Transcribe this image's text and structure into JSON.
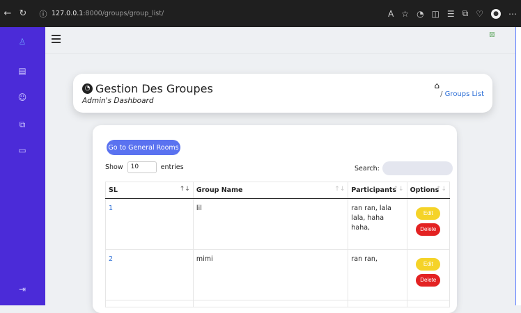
{
  "browser": {
    "url_host": "127.0.0.1",
    "url_rest": ":8000/groups/group_list/"
  },
  "header": {
    "title": "Gestion Des Groupes",
    "subtitle": "Admin's Dashboard",
    "breadcrumb_sep": "/",
    "breadcrumb_link": "Groups List"
  },
  "toolbar": {
    "rooms_button": "Go to General Rooms",
    "show_label": "Show",
    "entries_value": "10",
    "entries_label": "entries",
    "search_label": "Search:"
  },
  "table": {
    "columns": [
      "SL",
      "Group Name",
      "Participants",
      "Options"
    ],
    "rows": [
      {
        "sl": "1",
        "name": "lil",
        "participants": "ran ran, lala lala, haha haha,",
        "edit": "Edit",
        "delete": "Delete"
      },
      {
        "sl": "2",
        "name": "mimi",
        "participants": "ran ran,",
        "edit": "Edit",
        "delete": "Delete"
      }
    ]
  }
}
